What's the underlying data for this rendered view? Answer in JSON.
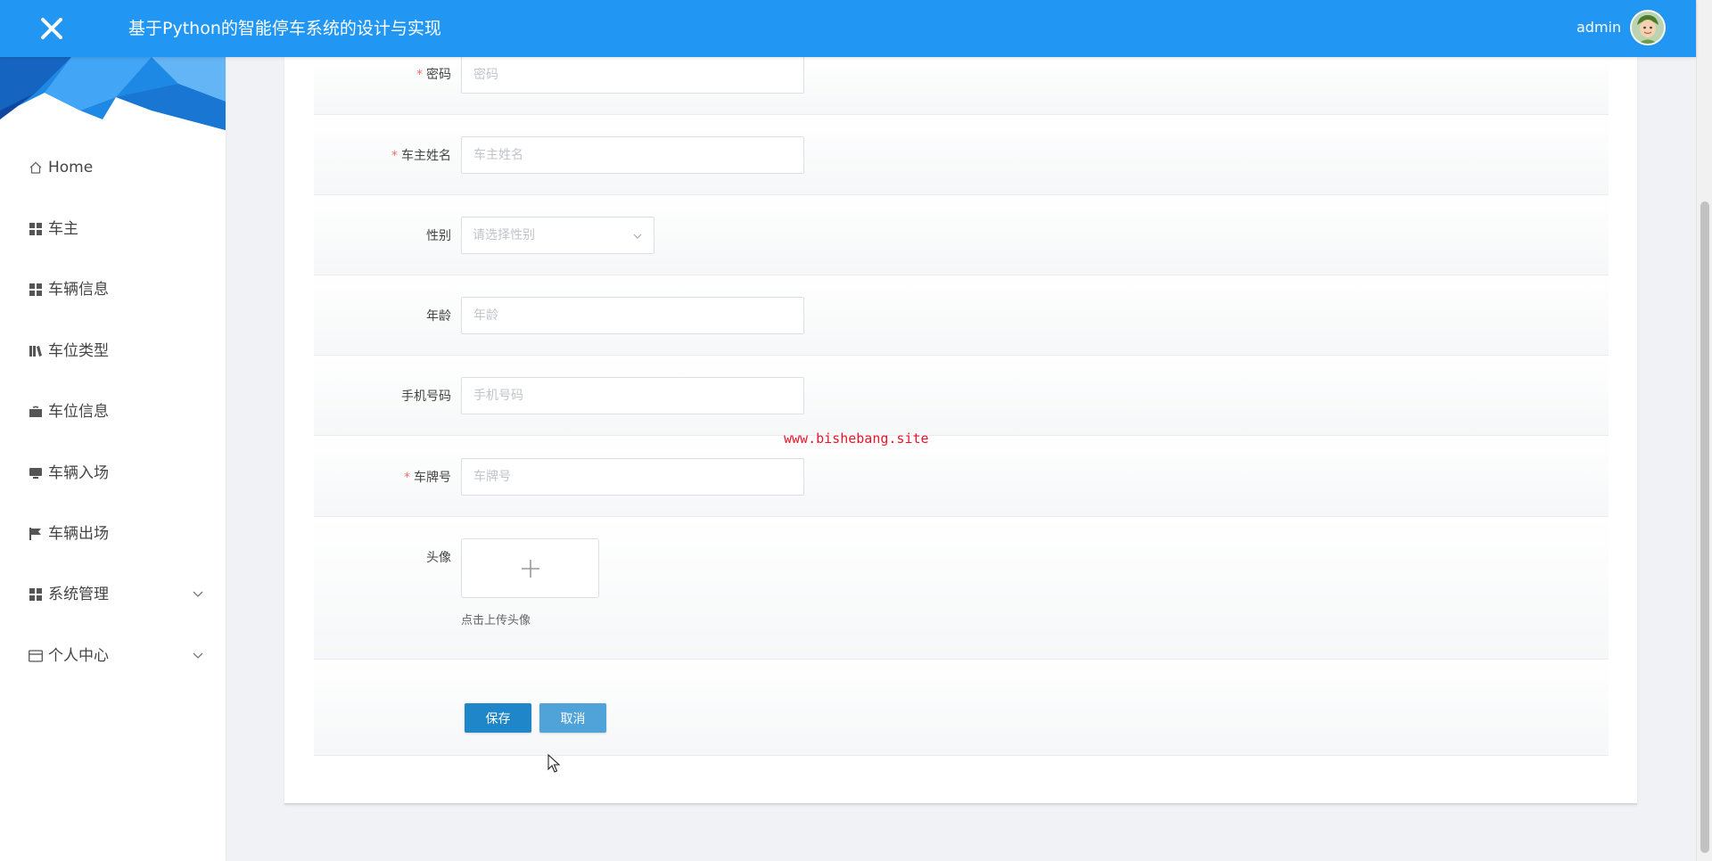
{
  "header": {
    "title": "基于Python的智能停车系统的设计与实现",
    "user_name": "admin",
    "background_color": "#2196F3"
  },
  "sidebar": {
    "items": [
      {
        "label": "Home",
        "icon": "home-icon"
      },
      {
        "label": "车主",
        "icon": "grid-icon"
      },
      {
        "label": "车辆信息",
        "icon": "grid-icon"
      },
      {
        "label": "车位类型",
        "icon": "book-icon"
      },
      {
        "label": "车位信息",
        "icon": "briefcase-icon"
      },
      {
        "label": "车辆入场",
        "icon": "monitor-icon"
      },
      {
        "label": "车辆出场",
        "icon": "flag-icon"
      },
      {
        "label": "系统管理",
        "icon": "grid-icon",
        "expandable": true
      },
      {
        "label": "个人中心",
        "icon": "card-icon",
        "expandable": true
      }
    ]
  },
  "form": {
    "password": {
      "label": "密码",
      "placeholder": "密码",
      "value": "",
      "required": true
    },
    "owner_name": {
      "label": "车主姓名",
      "placeholder": "车主姓名",
      "value": "",
      "required": true
    },
    "gender": {
      "label": "性别",
      "placeholder": "请选择性别",
      "value": ""
    },
    "age": {
      "label": "年龄",
      "placeholder": "年龄",
      "value": ""
    },
    "phone": {
      "label": "手机号码",
      "placeholder": "手机号码",
      "value": ""
    },
    "plate": {
      "label": "车牌号",
      "placeholder": "车牌号",
      "value": "",
      "required": true
    },
    "avatar": {
      "label": "头像",
      "tip": "点击上传头像"
    },
    "required_mark": "*",
    "save_label": "保存",
    "cancel_label": "取消"
  },
  "watermark": "www.bishebang.site",
  "colors": {
    "accent": "#2196F3",
    "save_button": "#1f87c9",
    "cancel_button": "#4fa3d8",
    "required": "#f56c6c",
    "watermark": "#e8152a"
  }
}
